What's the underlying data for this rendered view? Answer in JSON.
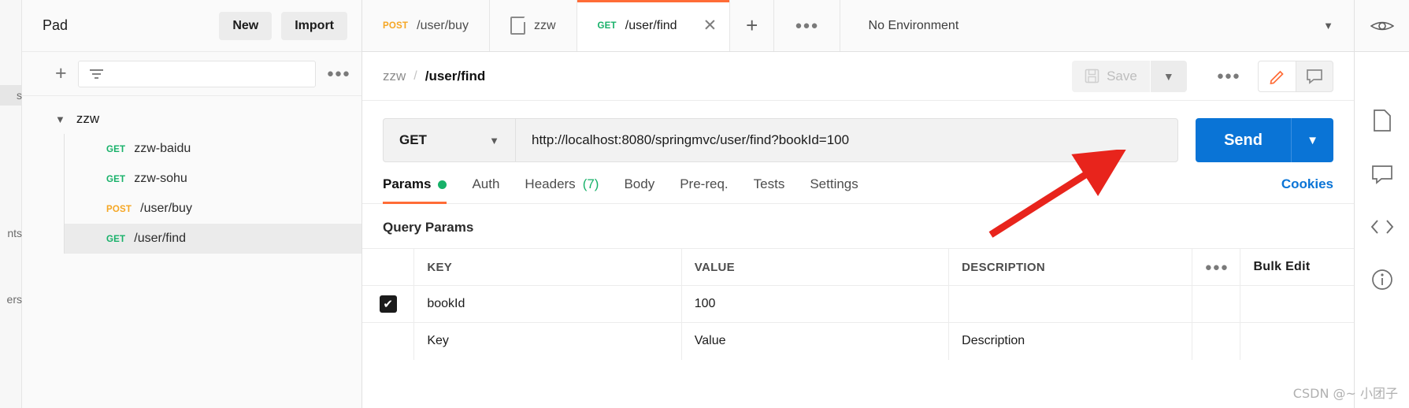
{
  "sidebar": {
    "title": "Pad",
    "new_label": "New",
    "import_label": "Import",
    "filter_placeholder": "",
    "more_icon": "ellipsis-icon",
    "rail_items": [
      {
        "label": "s",
        "active": true
      },
      {
        "label": "nts",
        "active": false
      },
      {
        "label": "ers",
        "active": false
      }
    ],
    "folder": {
      "name": "zzw",
      "expanded": true
    },
    "items": [
      {
        "method": "GET",
        "name": "zzw-baidu",
        "selected": false
      },
      {
        "method": "GET",
        "name": "zzw-sohu",
        "selected": false
      },
      {
        "method": "POST",
        "name": "/user/buy",
        "selected": false
      },
      {
        "method": "GET",
        "name": "/user/find",
        "selected": true
      }
    ]
  },
  "tabbar": {
    "tabs": [
      {
        "method": "POST",
        "label": "/user/buy",
        "active": false,
        "icon": ""
      },
      {
        "method": "",
        "label": "zzw",
        "active": false,
        "icon": "document-icon"
      },
      {
        "method": "GET",
        "label": "/user/find",
        "active": true,
        "icon": ""
      }
    ],
    "new_tab_icon": "plus-icon",
    "more_icon": "ellipsis-icon",
    "environment": "No Environment",
    "env_caret": "chevron-down-icon",
    "eye_icon": "eye-icon"
  },
  "breadcrumb": {
    "collection": "zzw",
    "separator": "/",
    "current": "/user/find",
    "save_label": "Save",
    "save_icon": "floppy-disk-icon",
    "save_caret": "chevron-down-icon",
    "more_icon": "ellipsis-icon",
    "edit_icon": "pencil-icon",
    "comment_icon": "comment-icon"
  },
  "request": {
    "method": "GET",
    "method_caret": "chevron-down-icon",
    "url": "http://localhost:8080/springmvc/user/find?bookId=100",
    "send_label": "Send",
    "send_caret": "chevron-down-icon",
    "send_color": "#0a74d6",
    "accent_color": "#ff6c37"
  },
  "request_tabs": {
    "items": [
      {
        "label": "Params",
        "active": true,
        "dot": true,
        "count": ""
      },
      {
        "label": "Auth",
        "active": false,
        "dot": false,
        "count": ""
      },
      {
        "label": "Headers",
        "active": false,
        "dot": false,
        "count": "(7)"
      },
      {
        "label": "Body",
        "active": false,
        "dot": false,
        "count": ""
      },
      {
        "label": "Pre-req.",
        "active": false,
        "dot": false,
        "count": ""
      },
      {
        "label": "Tests",
        "active": false,
        "dot": false,
        "count": ""
      },
      {
        "label": "Settings",
        "active": false,
        "dot": false,
        "count": ""
      }
    ],
    "cookies_label": "Cookies"
  },
  "params": {
    "section_title": "Query Params",
    "headers": [
      "KEY",
      "VALUE",
      "DESCRIPTION"
    ],
    "more_icon": "ellipsis-icon",
    "bulk_edit_label": "Bulk Edit",
    "rows": [
      {
        "checked": true,
        "check_glyph": "✔",
        "key": "bookId",
        "value": "100",
        "description": ""
      }
    ],
    "empty_row": {
      "key": "Key",
      "value": "Value",
      "description": "Description"
    }
  },
  "right_rail": {
    "icons": [
      "document-icon",
      "comment-icon",
      "code-icon",
      "info-icon"
    ]
  },
  "annotation": {
    "arrow_color": "#e8241c"
  },
  "watermark": "CSDN @~ 小团子"
}
